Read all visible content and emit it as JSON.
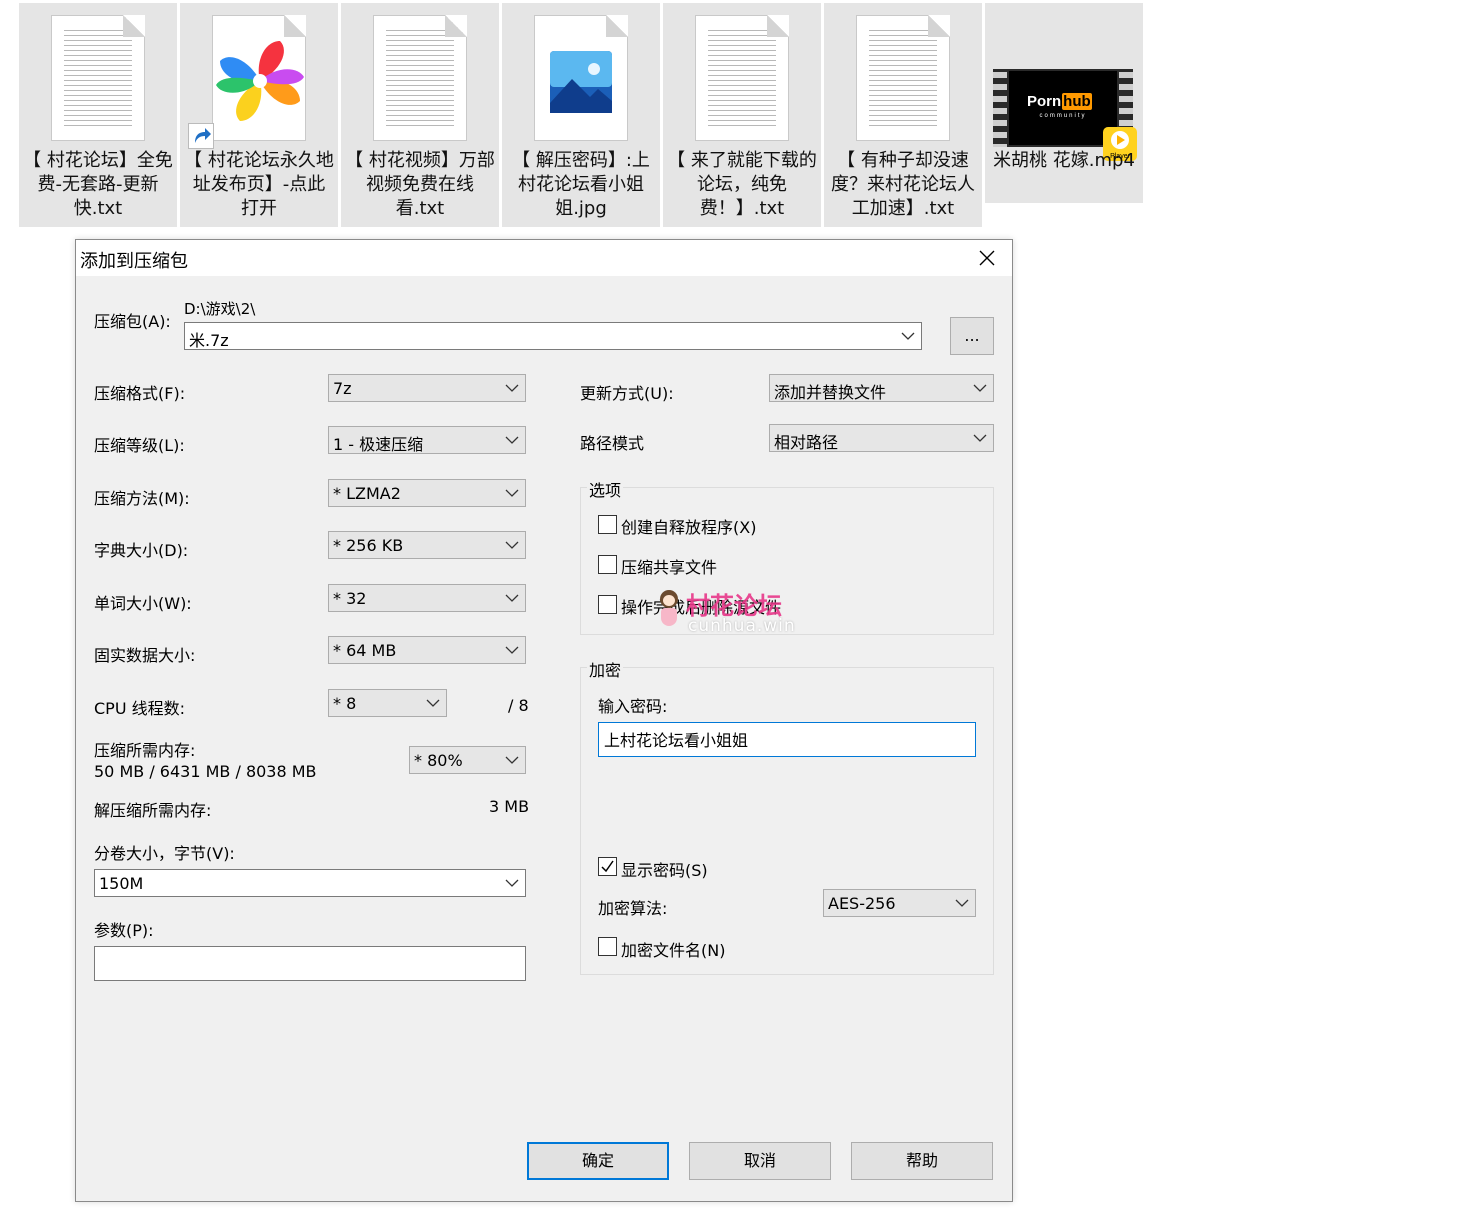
{
  "files": [
    {
      "name": "【 村花论坛】全免费-无套路-更新快.txt",
      "icon": "text-file-icon"
    },
    {
      "name": "【 村花论坛永久地址发布页】-点此打开",
      "icon": "browser-shortcut-icon"
    },
    {
      "name": "【 村花视频】万部视频免费在线看.txt",
      "icon": "text-file-icon"
    },
    {
      "name": "【 解压密码】:上村花论坛看小姐姐.jpg",
      "icon": "image-file-icon"
    },
    {
      "name": "【 来了就能下载的论坛，纯免费！】.txt",
      "icon": "text-file-icon"
    },
    {
      "name": "【 有种子却没速度？来村花论坛人工加速】.txt",
      "icon": "text-file-icon"
    },
    {
      "name": "米胡桃 花嫁.mp4",
      "icon": "video-file-icon",
      "thumb_logo": "Porn",
      "thumb_logo_box": "hub",
      "thumb_sub": "community",
      "thumb_badge": "Player"
    }
  ],
  "dialog": {
    "title": "添加到压缩包",
    "archive_label": "压缩包(A):",
    "archive_path": "D:\\游戏\\2\\",
    "archive_name": "米.7z",
    "browse_label": "...",
    "format_label": "压缩格式(F):",
    "format_value": "7z",
    "level_label": "压缩等级(L):",
    "level_value": "1 - 极速压缩",
    "method_label": "压缩方法(M):",
    "method_value": "*  LZMA2",
    "dict_label": "字典大小(D):",
    "dict_value": "*  256 KB",
    "word_label": "单词大小(W):",
    "word_value": "*  32",
    "solid_label": "固实数据大小:",
    "solid_value": "*  64 MB",
    "cpu_label": "CPU 线程数:",
    "cpu_value": "*  8",
    "cpu_total": "/ 8",
    "mem_label": "压缩所需内存:",
    "mem_value": "50 MB / 6431 MB / 8038 MB",
    "mem_percent": "* 80%",
    "decomp_label": "解压缩所需内存:",
    "decomp_value": "3 MB",
    "volume_label": "分卷大小，字节(V):",
    "volume_value": "150M",
    "params_label": "参数(P):",
    "params_value": "",
    "update_label": "更新方式(U):",
    "update_value": "添加并替换文件",
    "path_label": "路径模式",
    "path_value": "相对路径",
    "options_title": "选项",
    "opt_sfx": "创建自释放程序(X)",
    "opt_shared": "压缩共享文件",
    "opt_delete": "操作完成后删除源文件",
    "encryption_title": "加密",
    "password_label": "输入密码:",
    "password_value": "上村花论坛看小姐姐",
    "show_password": "显示密码(S)",
    "algo_label": "加密算法:",
    "algo_value": "AES-256",
    "encrypt_names": "加密文件名(N)",
    "ok": "确定",
    "cancel": "取消",
    "help": "帮助"
  },
  "watermark": {
    "title": "村花论坛",
    "url": "cunhua.win"
  },
  "colors": {
    "accent": "#0078d7",
    "dialog_bg": "#f0f0f0",
    "watermark": "#e8388a"
  }
}
